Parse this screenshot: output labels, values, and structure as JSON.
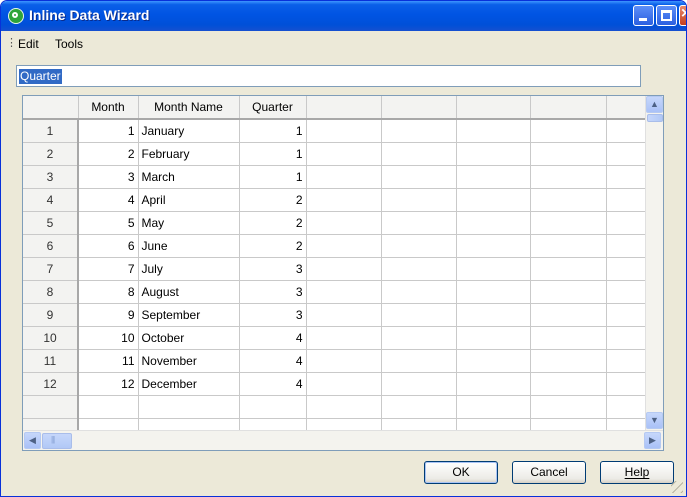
{
  "window": {
    "title": "Inline Data Wizard"
  },
  "menu": {
    "items": [
      "Edit",
      "Tools"
    ]
  },
  "expression_field": {
    "value": "Quarter"
  },
  "grid": {
    "columns": [
      "Month",
      "Month Name",
      "Quarter"
    ],
    "rows": [
      {
        "n": "1",
        "month": "1",
        "name": "January",
        "quarter": "1"
      },
      {
        "n": "2",
        "month": "2",
        "name": "February",
        "quarter": "1"
      },
      {
        "n": "3",
        "month": "3",
        "name": "March",
        "quarter": "1"
      },
      {
        "n": "4",
        "month": "4",
        "name": "April",
        "quarter": "2"
      },
      {
        "n": "5",
        "month": "5",
        "name": "May",
        "quarter": "2"
      },
      {
        "n": "6",
        "month": "6",
        "name": "June",
        "quarter": "2"
      },
      {
        "n": "7",
        "month": "7",
        "name": "July",
        "quarter": "3"
      },
      {
        "n": "8",
        "month": "8",
        "name": "August",
        "quarter": "3"
      },
      {
        "n": "9",
        "month": "9",
        "name": "September",
        "quarter": "3"
      },
      {
        "n": "10",
        "month": "10",
        "name": "October",
        "quarter": "4"
      },
      {
        "n": "11",
        "month": "11",
        "name": "November",
        "quarter": "4"
      },
      {
        "n": "12",
        "month": "12",
        "name": "December",
        "quarter": "4"
      }
    ]
  },
  "buttons": {
    "ok": "OK",
    "cancel": "Cancel",
    "help": "Help"
  },
  "colors": {
    "titlebar": "#0054e3",
    "selection": "#316ac5",
    "dialog": "#ece9d8"
  }
}
